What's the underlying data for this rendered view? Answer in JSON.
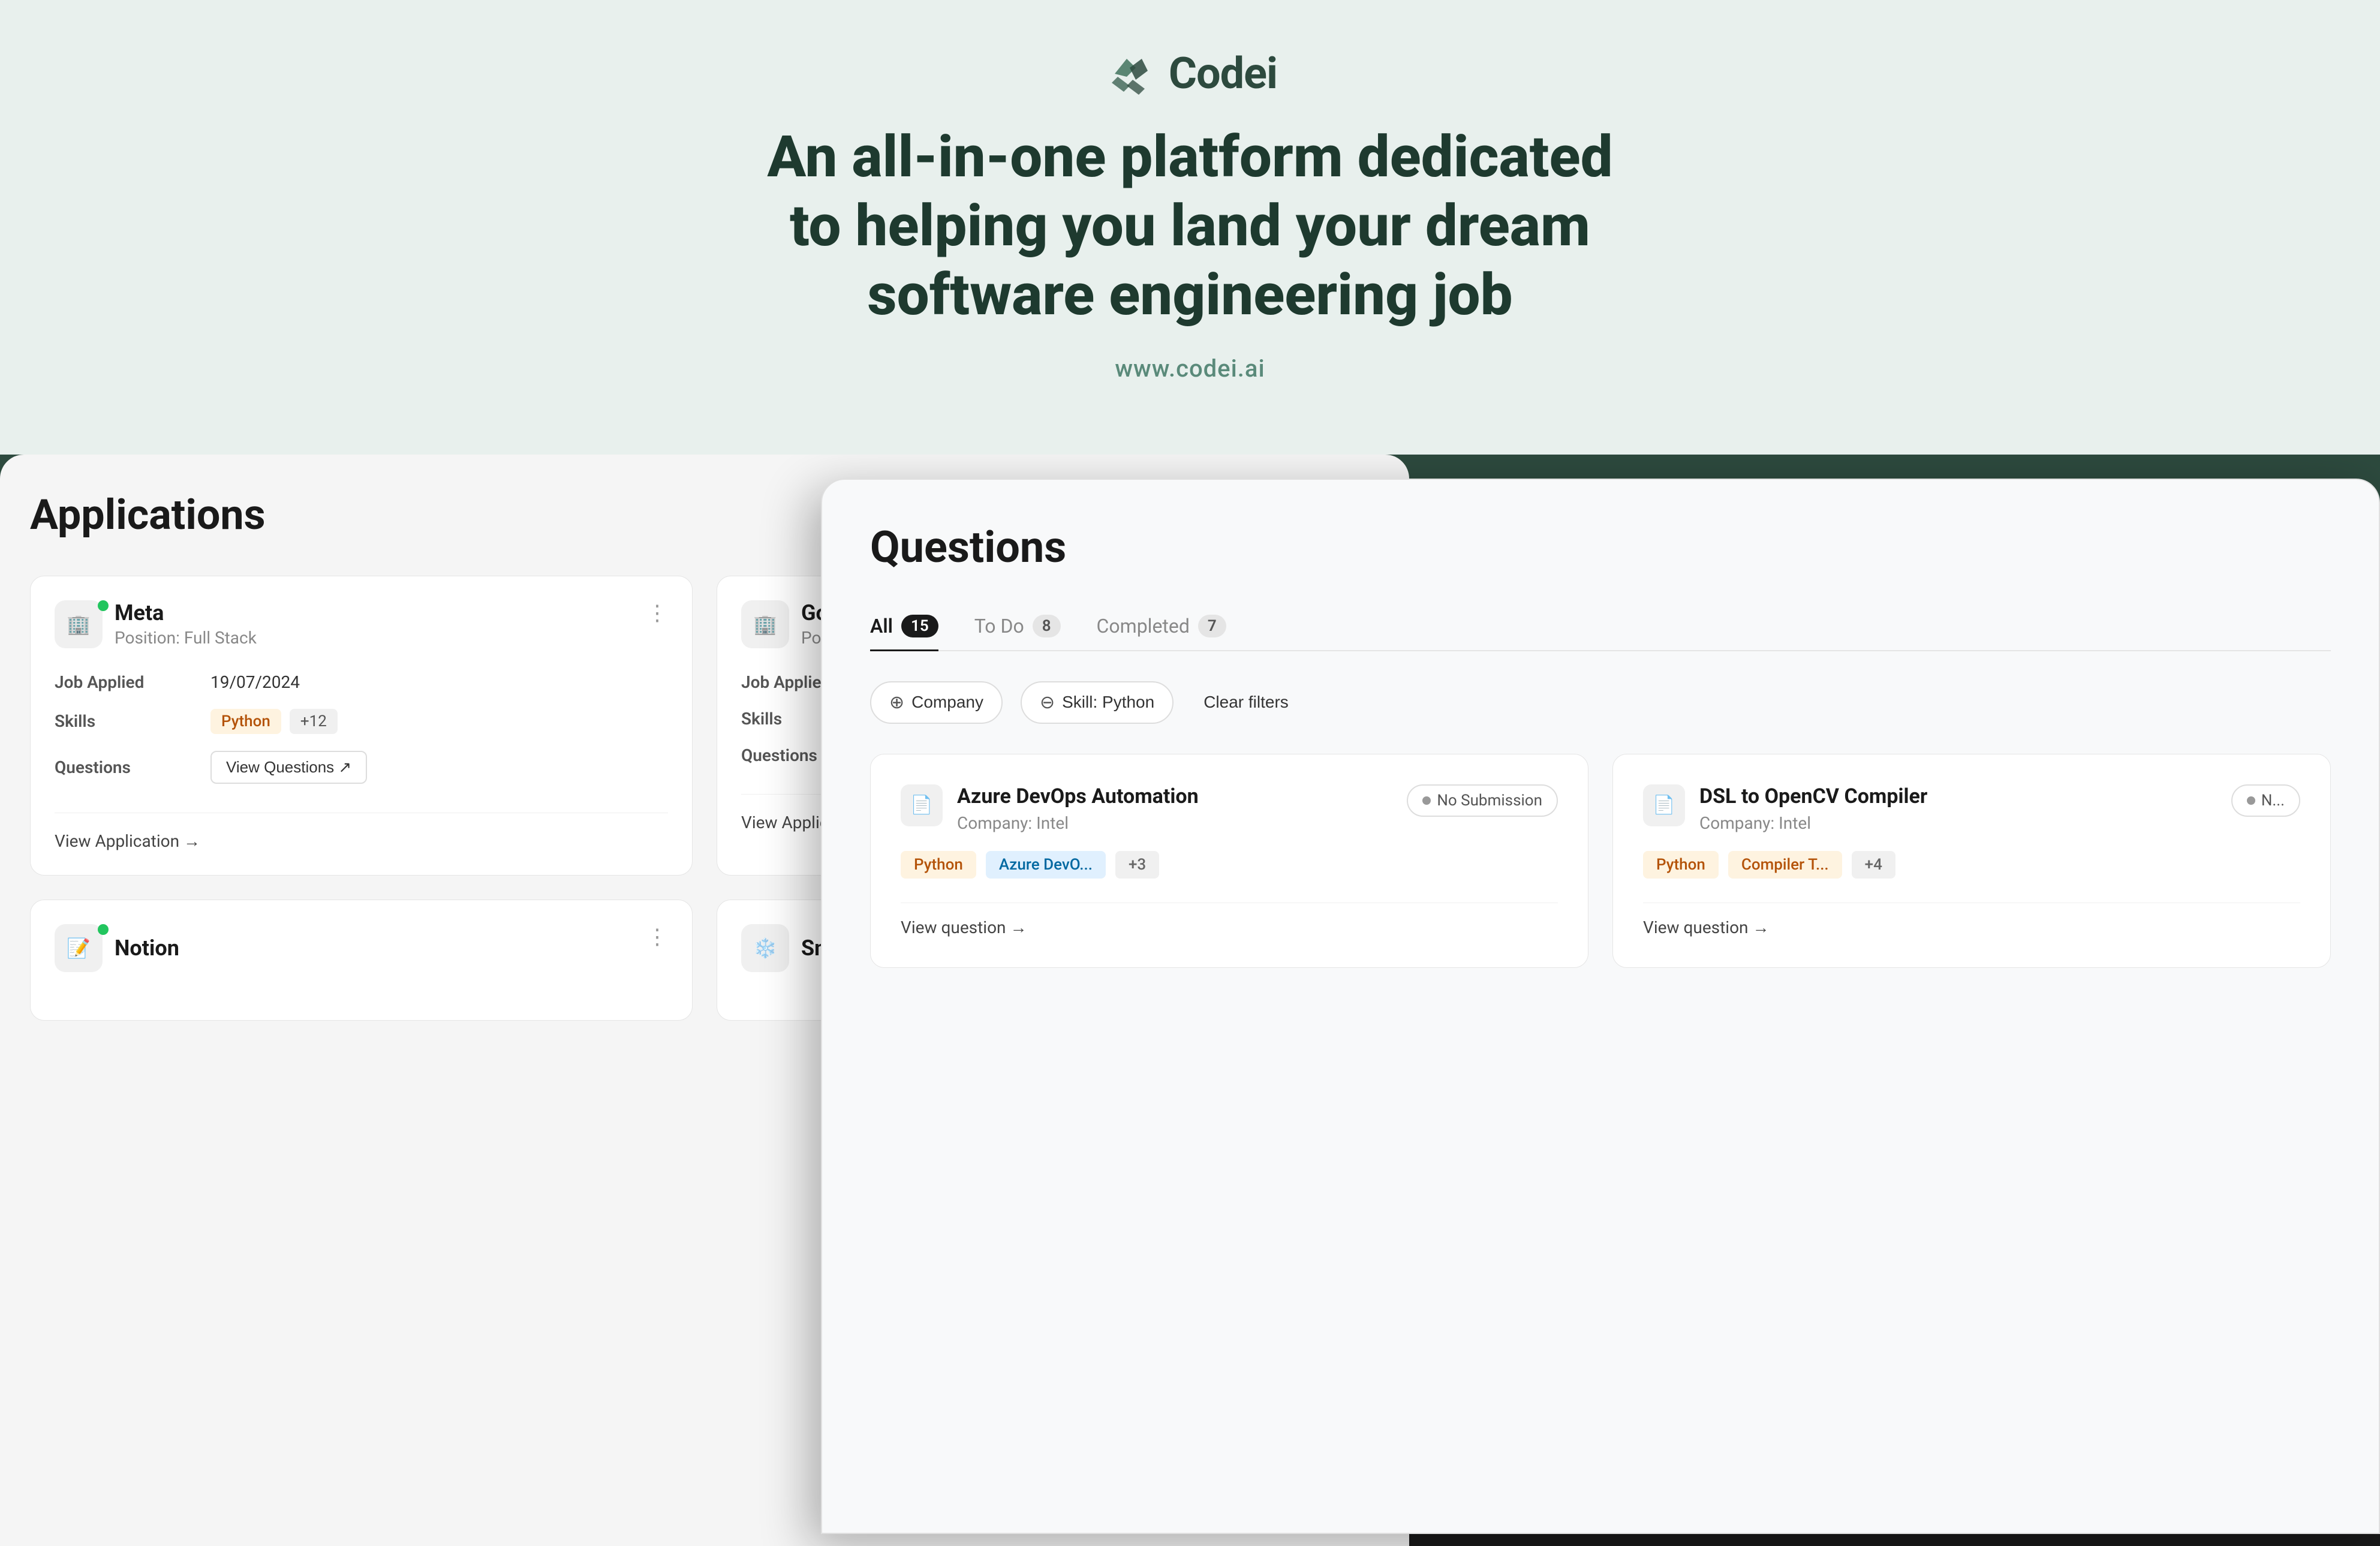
{
  "hero": {
    "logo_text": "Codei",
    "headline_line1": "An all-in-one platform dedicated",
    "headline_line2": "to helping you land your dream",
    "headline_line3": "software engineering job",
    "url": "www.codei.ai"
  },
  "applications": {
    "title": "Applications",
    "cards": [
      {
        "company": "Meta",
        "position": "Position: Full Stack",
        "status": "green",
        "job_applied_label": "Job Applied",
        "job_applied_date": "19/07/2024",
        "skills_label": "Skills",
        "skill_main": "Python",
        "skill_more": "+12",
        "questions_label": "Questions",
        "view_questions": "View Questions ↗",
        "view_application": "View Application →"
      },
      {
        "company": "Google",
        "position": "Position: Full S...",
        "status": "none",
        "job_applied_label": "Job Applied",
        "skills_label": "Skills",
        "questions_label": "Questions",
        "view_application": "View Application →"
      }
    ],
    "bottom_card": {
      "company": "Notion",
      "status": "green"
    },
    "bottom_card2": {
      "company": "Snowflake"
    }
  },
  "questions": {
    "title": "Questions",
    "tabs": [
      {
        "label": "All",
        "count": "15",
        "active": true
      },
      {
        "label": "To Do",
        "count": "8",
        "active": false
      },
      {
        "label": "Completed",
        "count": "7",
        "active": false
      }
    ],
    "filters": [
      {
        "label": "Company",
        "type": "add"
      },
      {
        "label": "Skill: Python",
        "type": "remove"
      }
    ],
    "clear_filters": "Clear filters",
    "question_cards": [
      {
        "title": "Azure DevOps Automation",
        "company": "Company: Intel",
        "status": "No Submission",
        "tags": [
          "Python",
          "Azure DevO...",
          "+3"
        ],
        "view_link": "View question →"
      },
      {
        "title": "DSL to OpenCV Compiler",
        "company": "Company: Intel",
        "status": "N...",
        "tags": [
          "Python",
          "Compiler T...",
          "+4"
        ],
        "view_link": "View question →"
      }
    ]
  },
  "bottom_bar": {
    "notion_text": "Notion"
  }
}
